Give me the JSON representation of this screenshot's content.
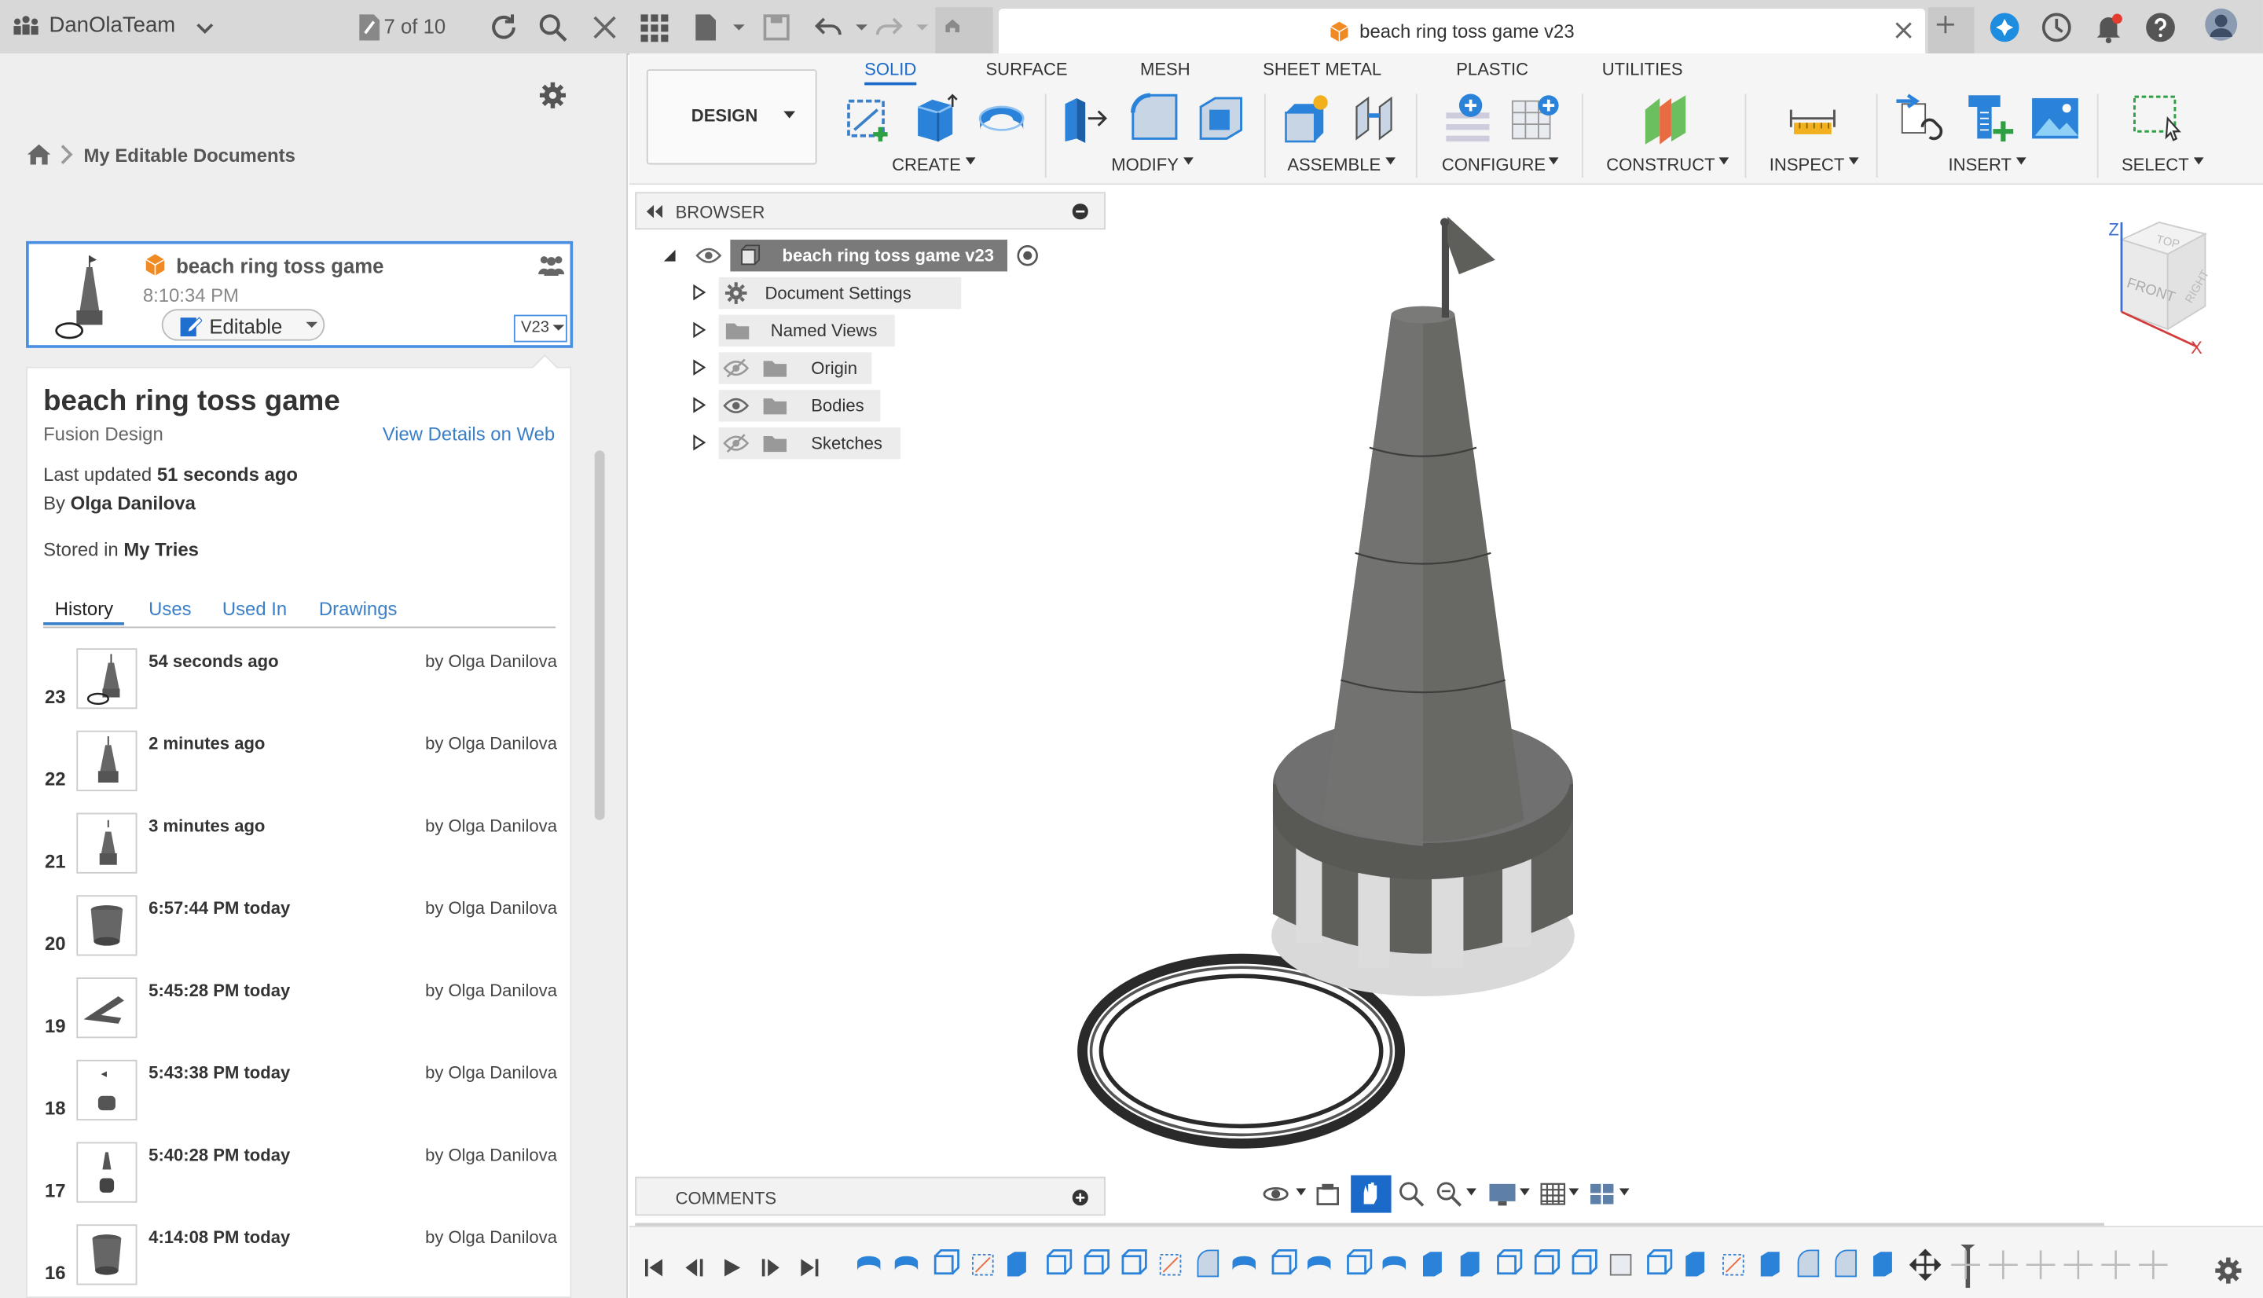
{
  "topbar": {
    "team": "DanOlaTeam",
    "version_counter": "7 of 10",
    "doc_tab_title": "beach ring toss game v23"
  },
  "data_panel": {
    "breadcrumb": "My Editable Documents",
    "card": {
      "title": "beach ring toss game",
      "time": "8:10:34 PM",
      "edit_state": "Editable",
      "version": "V23"
    },
    "details": {
      "title": "beach ring toss game",
      "type": "Fusion Design",
      "view_link": "View Details on Web",
      "last_updated_label": "Last updated",
      "last_updated_value": "51 seconds ago",
      "by_label": "By",
      "by_value": "Olga Danilova",
      "stored_label": "Stored in",
      "stored_value": "My Tries"
    },
    "tabs": [
      "History",
      "Uses",
      "Used In",
      "Drawings"
    ],
    "history": [
      {
        "num": "23",
        "time": "54 seconds ago",
        "by": "by Olga Danilova"
      },
      {
        "num": "22",
        "time": "2 minutes ago",
        "by": "by Olga Danilova"
      },
      {
        "num": "21",
        "time": "3 minutes ago",
        "by": "by Olga Danilova"
      },
      {
        "num": "20",
        "time": "6:57:44 PM today",
        "by": "by Olga Danilova"
      },
      {
        "num": "19",
        "time": "5:45:28 PM today",
        "by": "by Olga Danilova"
      },
      {
        "num": "18",
        "time": "5:43:38 PM today",
        "by": "by Olga Danilova"
      },
      {
        "num": "17",
        "time": "5:40:28 PM today",
        "by": "by Olga Danilova"
      },
      {
        "num": "16",
        "time": "4:14:08 PM today",
        "by": "by Olga Danilova"
      }
    ]
  },
  "toolbar": {
    "workspace": "DESIGN",
    "tabs": [
      "SOLID",
      "SURFACE",
      "MESH",
      "SHEET METAL",
      "PLASTIC",
      "UTILITIES"
    ],
    "groups": [
      "CREATE",
      "MODIFY",
      "ASSEMBLE",
      "CONFIGURE",
      "CONSTRUCT",
      "INSPECT",
      "INSERT",
      "SELECT"
    ]
  },
  "browser": {
    "title": "BROWSER",
    "root": "beach ring toss game v23",
    "items": [
      "Document Settings",
      "Named Views",
      "Origin",
      "Bodies",
      "Sketches"
    ]
  },
  "comments": {
    "title": "COMMENTS"
  },
  "viewcube": {
    "top": "TOP",
    "front": "FRONT",
    "right": "RIGHT",
    "axis_z": "Z",
    "axis_x": "X"
  },
  "colors": {
    "accent": "#1b6ac9",
    "model": "#6a6a66",
    "fusion_orange": "#f08a24"
  }
}
